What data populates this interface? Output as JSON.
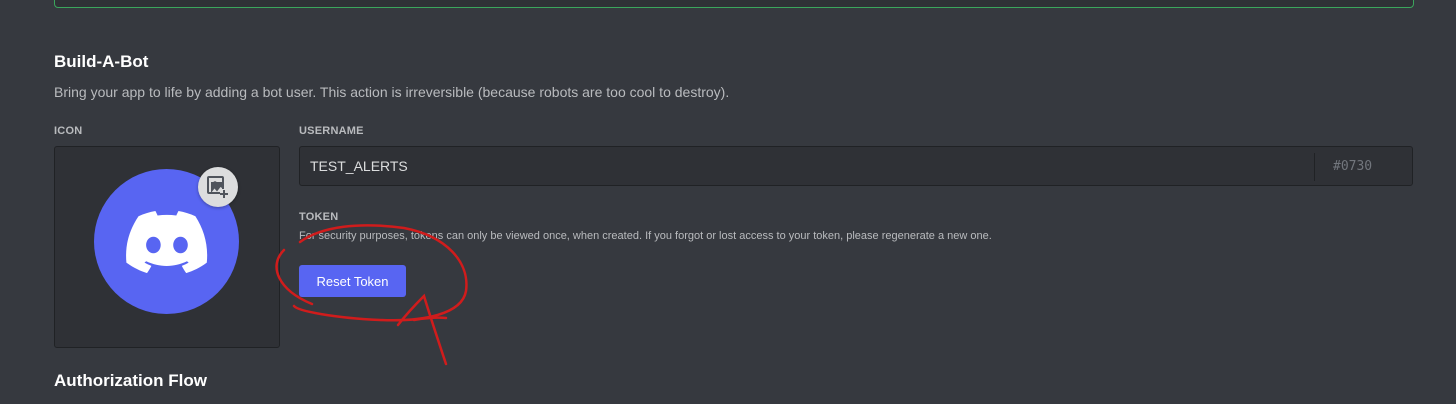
{
  "build_a_bot": {
    "title": "Build-A-Bot",
    "description": "Bring your app to life by adding a bot user. This action is irreversible (because robots are too cool to destroy).",
    "icon_label": "ICON",
    "username_label": "USERNAME",
    "username_value": "TEST_ALERTS",
    "discriminator": "#0730",
    "token_label": "TOKEN",
    "token_description": "For security purposes, tokens can only be viewed once, when created. If you forgot or lost access to your token, please regenerate a new one.",
    "reset_token_label": "Reset Token"
  },
  "authorization_flow": {
    "title": "Authorization Flow"
  },
  "icons": {
    "avatar": "discord-logo-icon",
    "upload": "image-add-icon"
  },
  "colors": {
    "background": "#36393f",
    "accent": "#5865f2",
    "notice_border": "#3ba55c",
    "annotation": "#d01c1c"
  }
}
